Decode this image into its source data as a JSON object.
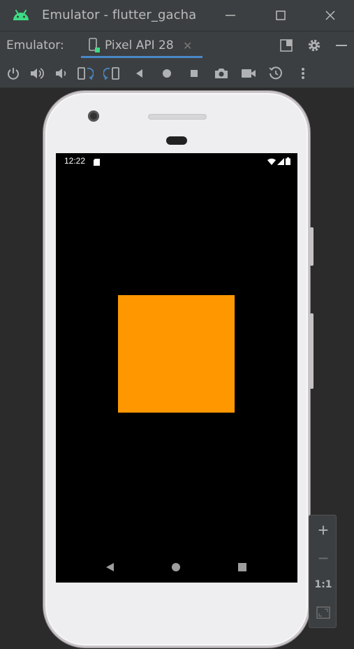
{
  "window": {
    "title": "Emulator - flutter_gacha",
    "controls": [
      "minimize-icon",
      "maximize-icon",
      "close-icon"
    ]
  },
  "tabbar": {
    "label": "Emulator:",
    "tabs": [
      {
        "label": "Pixel API 28",
        "icon": "device-icon",
        "active": true
      }
    ],
    "right_icons": [
      "window-mode-icon",
      "gear-icon",
      "hide-icon"
    ]
  },
  "toolbar": {
    "icons": [
      "power-icon",
      "volume-up-icon",
      "volume-down-icon",
      "rotate-left-icon",
      "rotate-right-icon",
      "back-icon",
      "home-icon",
      "overview-icon",
      "screenshot-icon",
      "screen-record-icon",
      "snapshot-icon",
      "more-icon"
    ]
  },
  "device": {
    "status_bar": {
      "time": "12:22",
      "icons": [
        "sd-card-icon",
        "wifi-icon",
        "signal-icon",
        "battery-icon"
      ]
    },
    "app": {
      "box_color": "#ff9800"
    },
    "navigation": [
      "nav-back-icon",
      "nav-home-icon",
      "nav-recents-icon"
    ]
  },
  "zoom_panel": {
    "zoom_in": "+",
    "zoom_out": "−",
    "actual_size": "1:1",
    "fit_icon": "zoom-fit-icon"
  },
  "colors": {
    "accent_underline": "#4a88c7",
    "android_green": "#3ddc84",
    "orange": "#ff9800"
  }
}
